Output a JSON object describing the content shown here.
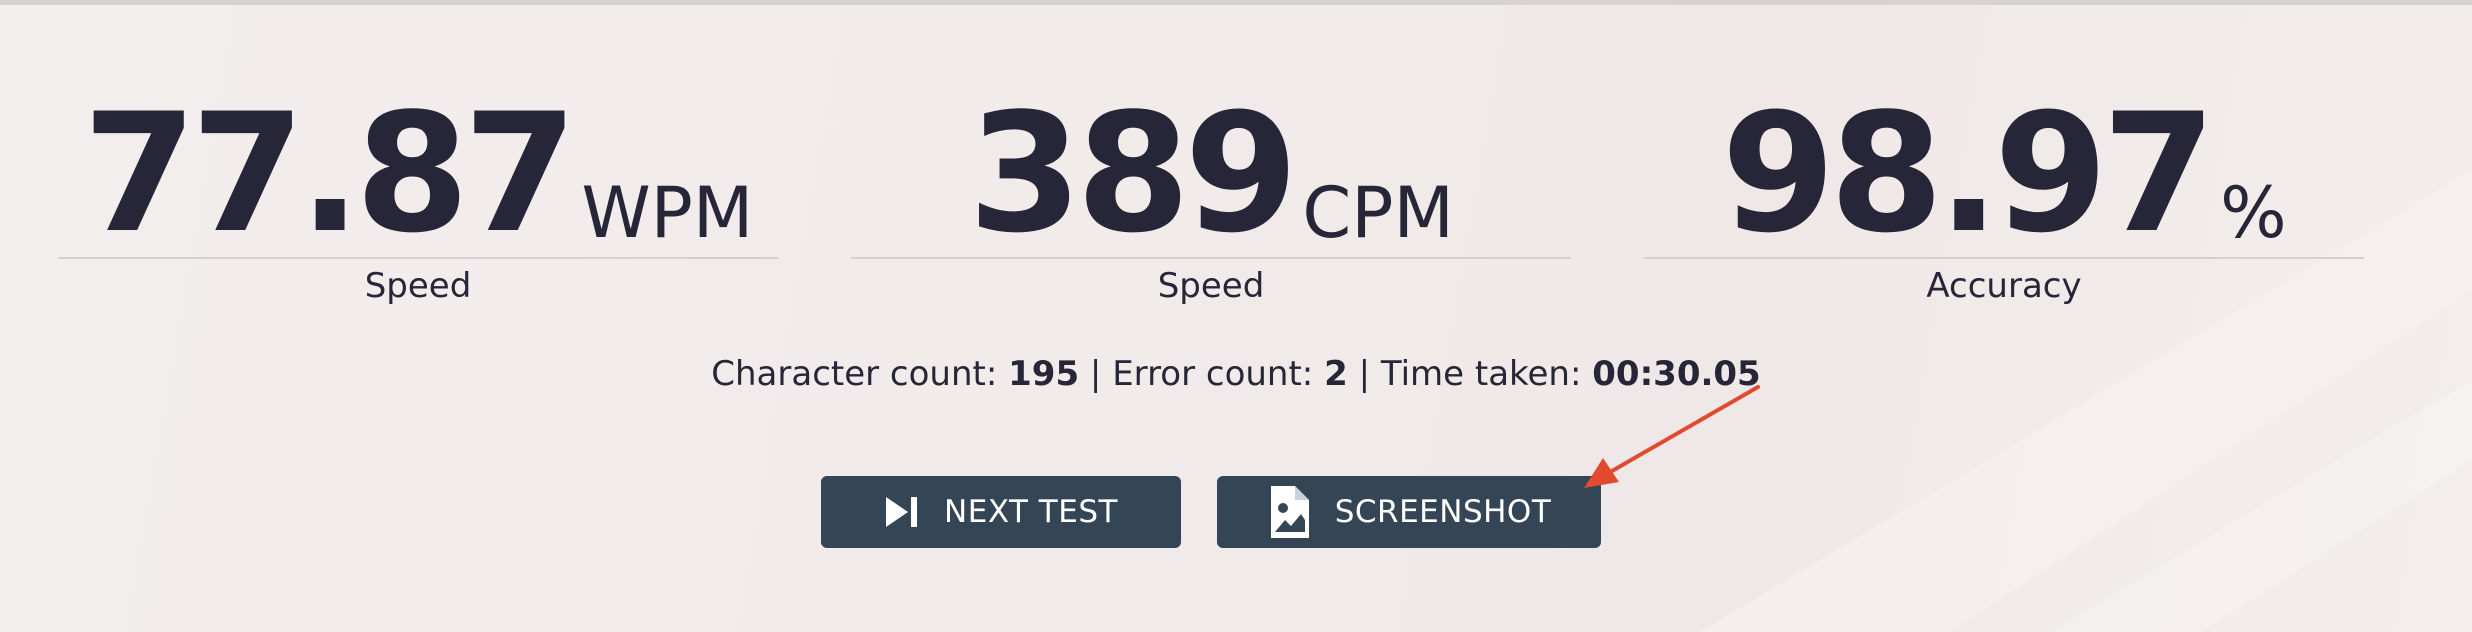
{
  "stats": [
    {
      "value": "77.87",
      "unit": "WPM",
      "label": "Speed"
    },
    {
      "value": "389",
      "unit": "CPM",
      "label": "Speed"
    },
    {
      "value": "98.97",
      "unit": "%",
      "label": "Accuracy"
    }
  ],
  "summary": {
    "char_label": "Character count:",
    "char_value": "195",
    "sep1": "|",
    "error_label": "Error count:",
    "error_value": "2",
    "sep2": "|",
    "time_label": "Time taken:",
    "time_value": "00:30.05"
  },
  "buttons": {
    "next_test": {
      "label": "NEXT TEST",
      "icon": "skip-next-icon"
    },
    "screenshot": {
      "label": "SCREENSHOT",
      "icon": "image-file-icon"
    }
  },
  "colors": {
    "text": "#262638",
    "button_bg": "#344556",
    "annotation_arrow": "#e04a2e"
  }
}
